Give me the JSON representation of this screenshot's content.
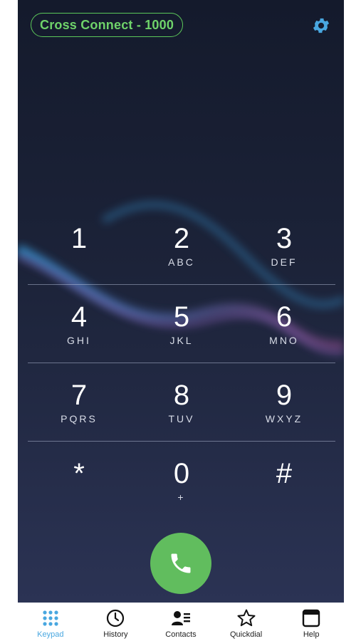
{
  "header": {
    "account_label": "Cross Connect - 1000"
  },
  "colors": {
    "accent_green": "#61bd5e",
    "accent_blue": "#49a7e0",
    "background": "#1c2339"
  },
  "icons": {
    "settings": "gear-icon",
    "call": "phone-icon",
    "keypad": "grid-icon",
    "history": "clock-icon",
    "contacts": "contacts-icon",
    "quickdial": "star-icon",
    "help": "window-icon"
  },
  "keypad": {
    "rows": [
      [
        {
          "digit": "1",
          "letters": ""
        },
        {
          "digit": "2",
          "letters": "ABC"
        },
        {
          "digit": "3",
          "letters": "DEF"
        }
      ],
      [
        {
          "digit": "4",
          "letters": "GHI"
        },
        {
          "digit": "5",
          "letters": "JKL"
        },
        {
          "digit": "6",
          "letters": "MNO"
        }
      ],
      [
        {
          "digit": "7",
          "letters": "PQRS"
        },
        {
          "digit": "8",
          "letters": "TUV"
        },
        {
          "digit": "9",
          "letters": "WXYZ"
        }
      ],
      [
        {
          "digit": "*",
          "letters": ""
        },
        {
          "digit": "0",
          "letters": "+"
        },
        {
          "digit": "#",
          "letters": ""
        }
      ]
    ]
  },
  "tabs": [
    {
      "label": "Keypad",
      "active": true
    },
    {
      "label": "History",
      "active": false
    },
    {
      "label": "Contacts",
      "active": false
    },
    {
      "label": "Quickdial",
      "active": false
    },
    {
      "label": "Help",
      "active": false
    }
  ]
}
